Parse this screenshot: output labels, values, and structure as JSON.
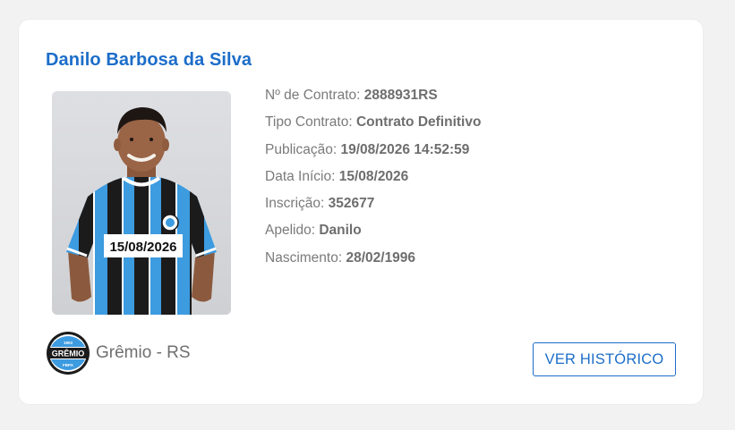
{
  "player": {
    "name": "Danilo Barbosa da Silva",
    "photo_date_tag": "15/08/2026"
  },
  "details": [
    {
      "label": "Nº de Contrato:",
      "value": "2888931RS"
    },
    {
      "label": "Tipo Contrato:",
      "value": "Contrato Definitivo"
    },
    {
      "label": "Publicação:",
      "value": "19/08/2026 14:52:59"
    },
    {
      "label": "Data Início:",
      "value": "15/08/2026"
    },
    {
      "label": "Inscrição:",
      "value": "352677"
    },
    {
      "label": "Apelido:",
      "value": "Danilo"
    },
    {
      "label": "Nascimento:",
      "value": "28/02/1996"
    }
  ],
  "club": {
    "name": "Grêmio - RS",
    "badge_text": "GRÊMIO",
    "badge_year": "1903",
    "badge_bottom": "FBPA",
    "badge_icon": "club-crest"
  },
  "actions": {
    "history_label": "VER HISTÓRICO"
  },
  "colors": {
    "accent": "#1c6dc9",
    "jersey_blue": "#3d9be0",
    "jersey_black": "#1b1b1b"
  }
}
